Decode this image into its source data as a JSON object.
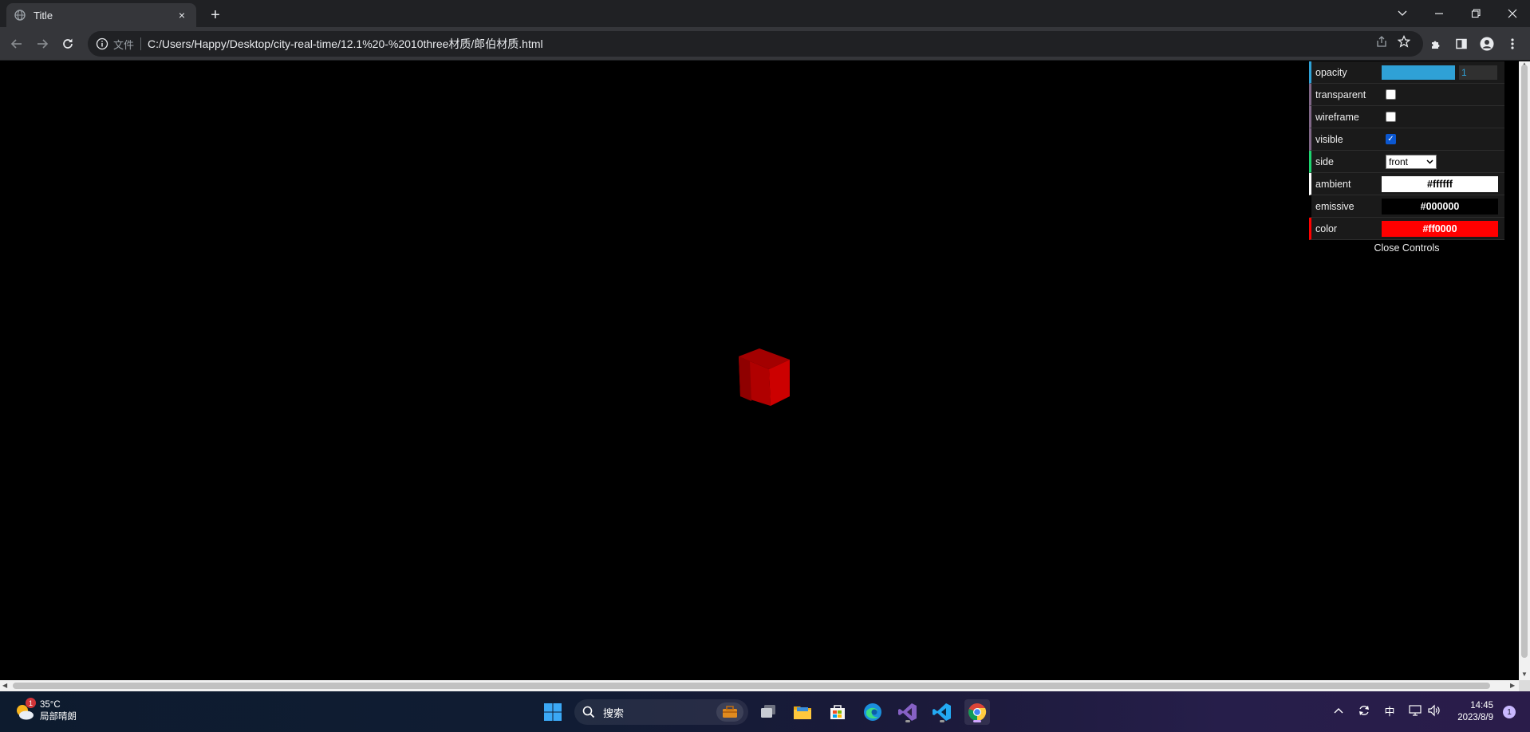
{
  "browser": {
    "tab_title": "Title",
    "tab_close": "×",
    "new_tab": "+",
    "address_file_label": "文件",
    "address_url": "C:/Users/Happy/Desktop/city-real-time/12.1%20-%2010three材质/郎伯材质.html"
  },
  "gui": {
    "rows": [
      {
        "label": "opacity",
        "value": "1",
        "fraction": 1.0,
        "accent": "#2fa1d6"
      },
      {
        "label": "transparent",
        "checked": false,
        "accent": "#806787"
      },
      {
        "label": "wireframe",
        "checked": false,
        "accent": "#806787"
      },
      {
        "label": "visible",
        "checked": true,
        "accent": "#806787"
      },
      {
        "label": "side",
        "value": "front",
        "accent": "#1ed36f"
      },
      {
        "label": "ambient",
        "value": "#ffffff",
        "bg": "#ffffff",
        "fg": "#000000",
        "accent": "#ffffff"
      },
      {
        "label": "emissive",
        "value": "#000000",
        "bg": "#000000",
        "fg": "#ffffff",
        "accent": "#000000"
      },
      {
        "label": "color",
        "value": "#ff0000",
        "bg": "#ff0000",
        "fg": "#ffffff",
        "accent": "#ff0000"
      }
    ],
    "close_label": "Close Controls"
  },
  "scene": {
    "background": "#000000",
    "cube_color": "#cc0000"
  },
  "taskbar": {
    "weather_temp": "35°C",
    "weather_desc": "局部晴朗",
    "weather_badge": "1",
    "search_label": "搜索",
    "ime_label": "中",
    "time": "14:45",
    "date": "2023/8/9",
    "notification_count": "1"
  }
}
